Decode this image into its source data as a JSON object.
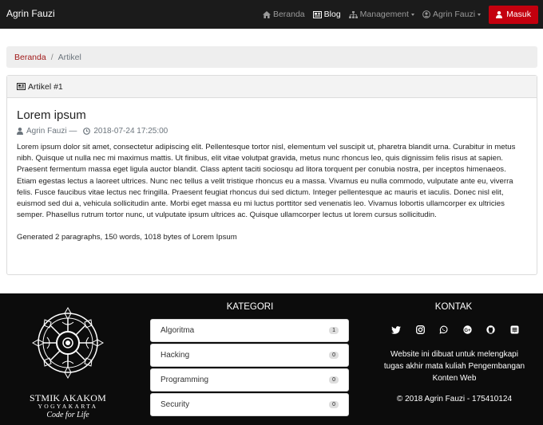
{
  "navbar": {
    "brand": "Agrin Fauzi",
    "items": [
      {
        "label": "Beranda",
        "icon": "home-icon"
      },
      {
        "label": "Blog",
        "icon": "newspaper-icon"
      },
      {
        "label": "Management",
        "icon": "sitemap-icon"
      },
      {
        "label": "Agrin Fauzi",
        "icon": "user-circle-icon"
      }
    ],
    "login_label": "Masuk",
    "login_color": "#c4000e"
  },
  "breadcrumb": {
    "home": "Beranda",
    "separator": "/",
    "current": "Artikel"
  },
  "card": {
    "header": "Artikel #1",
    "title": "Lorem ipsum",
    "author": "Agrin Fauzi —",
    "date": "2018-07-24 17:25:00",
    "content": "Lorem ipsum dolor sit amet, consectetur adipiscing elit. Pellentesque tortor nisl, elementum vel suscipit ut, pharetra blandit urna. Curabitur in metus nibh. Quisque ut nulla nec mi maximus mattis. Ut finibus, elit vitae volutpat gravida, metus nunc rhoncus leo, quis dignissim felis risus at sapien. Praesent fermentum massa eget ligula auctor blandit. Class aptent taciti sociosqu ad litora torquent per conubia nostra, per inceptos himenaeos. Etiam egestas lectus a laoreet ultrices. Nunc nec tellus a velit tristique rhoncus eu a massa. Vivamus eu nulla commodo, vulputate ante eu, viverra felis. Fusce faucibus vitae lectus nec fringilla. Praesent feugiat rhoncus dui sed dictum. Integer pellentesque ac mauris et iaculis. Donec nisl elit, euismod sed dui a, vehicula sollicitudin ante. Morbi eget massa eu mi luctus porttitor sed venenatis leo. Vivamus lobortis ullamcorper ex ultricies semper. Phasellus rutrum tortor nunc, ut vulputate ipsum ultrices ac. Quisque ullamcorper lectus ut lorem cursus sollicitudin.",
    "generated": "Generated 2 paragraphs, 150 words, 1018 bytes of Lorem Ipsum"
  },
  "footer": {
    "logo": {
      "line1": "STMIK AKAKOM",
      "line2": "YOGYAKARTA",
      "line3": "Code for Life"
    },
    "kategori_title": "KATEGORI",
    "kategori": [
      {
        "label": "Algoritma",
        "count": "1"
      },
      {
        "label": "Hacking",
        "count": "0"
      },
      {
        "label": "Programming",
        "count": "0"
      },
      {
        "label": "Security",
        "count": "0"
      }
    ],
    "kontak_title": "KONTAK",
    "social_icons": [
      "twitter-icon",
      "instagram-icon",
      "whatsapp-icon",
      "google-plus-icon",
      "github-icon",
      "stack-exchange-icon"
    ],
    "kontak_text": "Website ini dibuat untuk melengkapi tugas akhir mata kuliah Pengembangan Konten Web",
    "copyright": "© 2018 Agrin Fauzi - 175410124"
  }
}
